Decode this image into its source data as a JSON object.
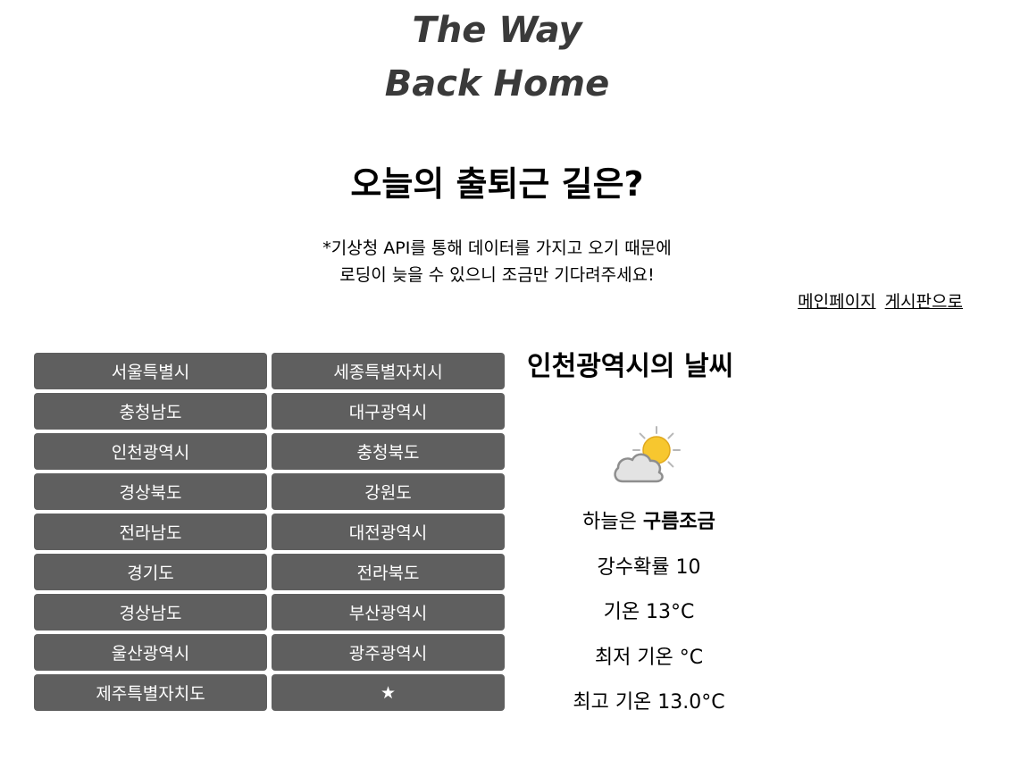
{
  "logo": {
    "line1": "The Way",
    "line2": "Back Home"
  },
  "headline": "오늘의 출퇴근 길은?",
  "notice": {
    "line1": "*기상청 API를 통해 데이터를 가지고 오기 때문에",
    "line2": "로딩이 늦을 수 있으니 조금만 기다려주세요!"
  },
  "nav": {
    "main_page": "메인페이지",
    "board": "게시판으로"
  },
  "regions": [
    "서울특별시",
    "세종특별자치시",
    "충청남도",
    "대구광역시",
    "인천광역시",
    "충청북도",
    "경상북도",
    "강원도",
    "전라남도",
    "대전광역시",
    "경기도",
    "전라북도",
    "경상남도",
    "부산광역시",
    "울산광역시",
    "광주광역시",
    "제주특별자치도",
    "★"
  ],
  "weather": {
    "title": "인천광역시의 날씨",
    "icon": "partly-cloudy-icon",
    "sky_label": "하늘은",
    "sky_value": "구름조금",
    "rain_prob": "강수확률 10",
    "temp": "기온 13°C",
    "temp_min": "최저 기온 °C",
    "temp_max": "최고 기온 13.0°C"
  },
  "colors": {
    "button_bg": "#5f5f5f",
    "button_text": "#ffffff",
    "logo": "#3a3a3a",
    "sun": "#f7c72f",
    "cloud": "#e3e3e3"
  }
}
